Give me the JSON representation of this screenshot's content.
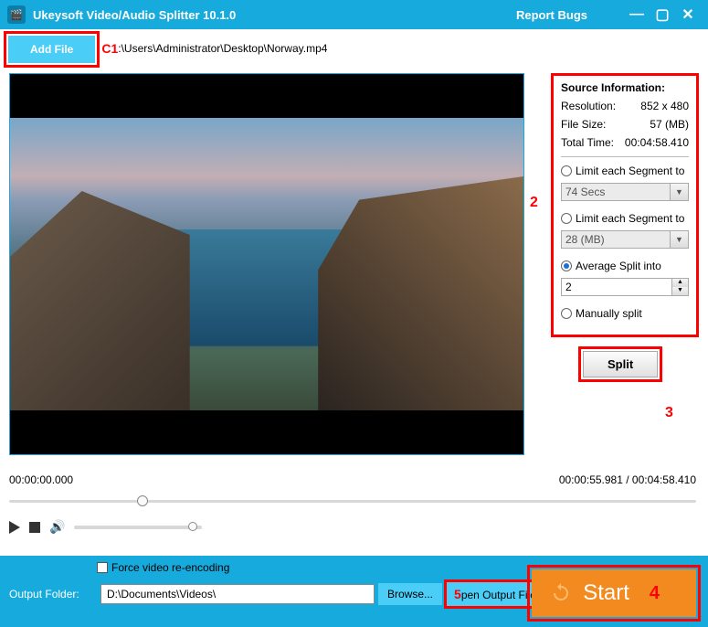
{
  "titlebar": {
    "app_title": "Ukeysoft Video/Audio Splitter 10.1.0",
    "report": "Report Bugs"
  },
  "add_file_label": "Add File",
  "file_path": ":\\Users\\Administrator\\Desktop\\Norway.mp4",
  "annotations": {
    "one": "C1",
    "two": "2",
    "three": "3",
    "four": "4",
    "five": "5"
  },
  "time": {
    "start": "00:00:00.000",
    "current": "00:00:55.981",
    "total": "00:04:58.410",
    "sep": " / "
  },
  "source_info": {
    "header": "Source Information:",
    "resolution_label": "Resolution:",
    "resolution_value": "852 x 480",
    "filesize_label": "File Size:",
    "filesize_value": "57 (MB)",
    "totaltime_label": "Total Time:",
    "totaltime_value": "00:04:58.410"
  },
  "options": {
    "limit_secs_label": "Limit each Segment to",
    "limit_secs_value": "74 Secs",
    "limit_mb_label": "Limit each Segment to",
    "limit_mb_value": "28 (MB)",
    "avg_label": "Average Split into",
    "avg_value": "2",
    "manual_label": "Manually split"
  },
  "split_label": "Split",
  "bottom": {
    "force_label": "Force video re-encoding",
    "output_label": "Output Folder:",
    "output_value": "D:\\Documents\\Videos\\",
    "browse_label": "Browse...",
    "open_label": "pen Output File",
    "start_label": "Start"
  }
}
